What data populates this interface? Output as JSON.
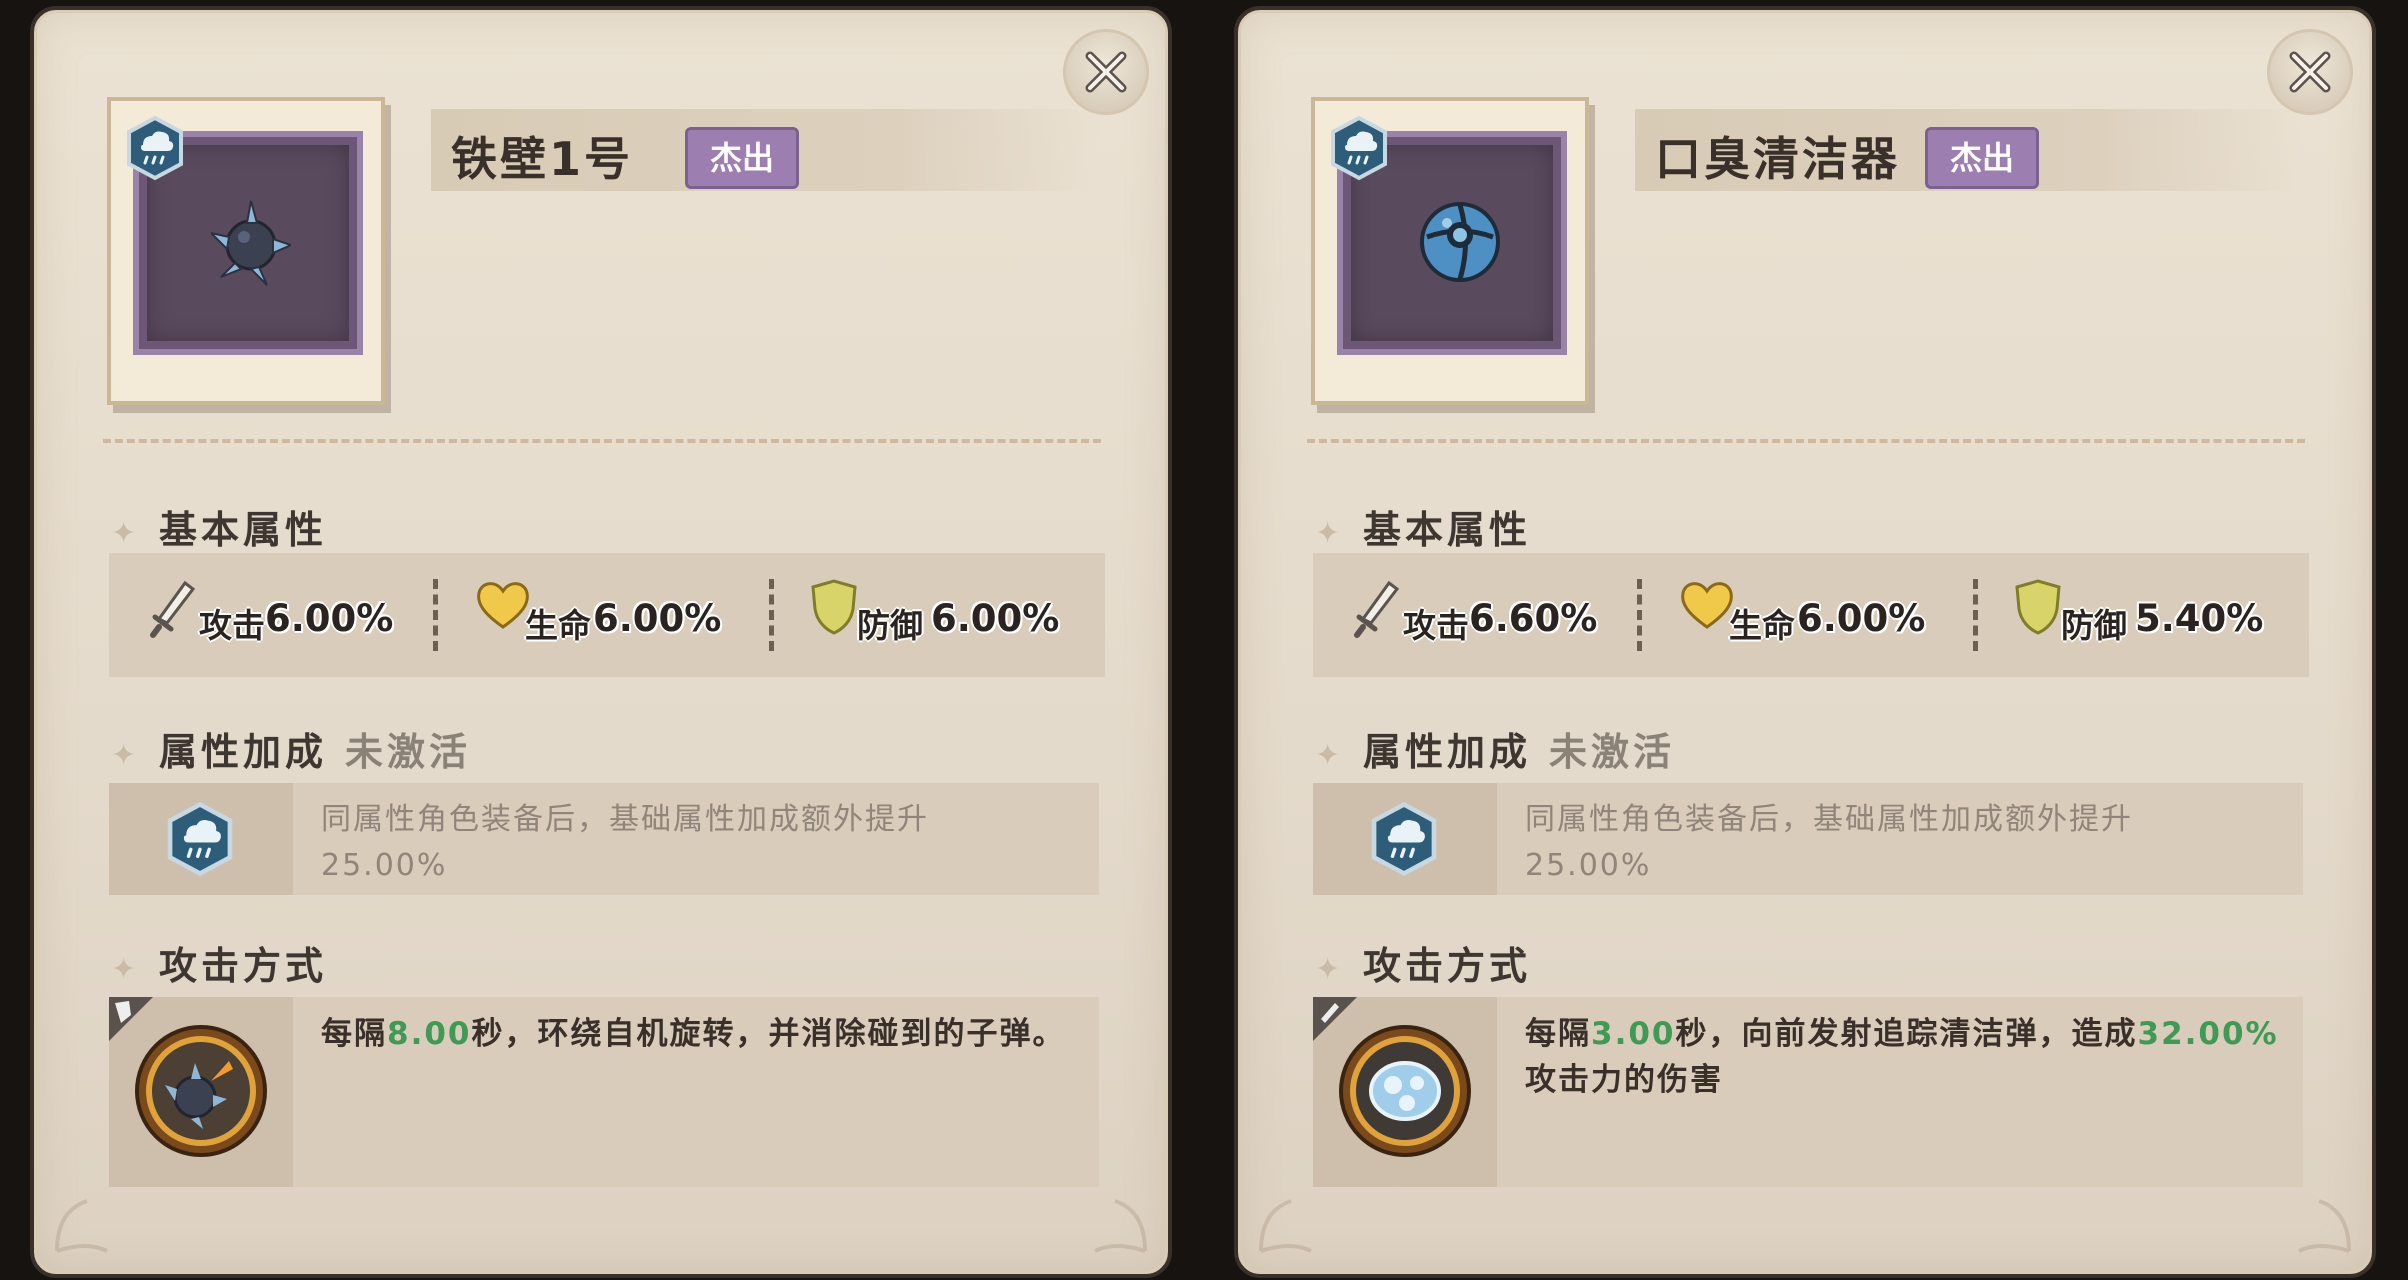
{
  "panels": [
    {
      "item_name": "铁壁1号",
      "rarity": "杰出",
      "sections": {
        "basic": "基本属性",
        "bonus": "属性加成",
        "bonus_status": "未激活",
        "attack": "攻击方式"
      },
      "stats": [
        {
          "label": "攻击",
          "value": "6.00%",
          "icon": "sword-icon"
        },
        {
          "label": "生命",
          "value": "6.00%",
          "icon": "heart-icon"
        },
        {
          "label": "防御",
          "value": "6.00%",
          "icon": "shield-icon"
        }
      ],
      "bonus_text_1": "同属性角色装备后，基础属性加成额外提升",
      "bonus_text_2": "25.00%",
      "attack_pre": "每隔",
      "attack_hl1": "8.00",
      "attack_mid": "秒，环绕自机旋转，并消除碰到的子弹。",
      "attack_hl2": "",
      "attack_post": "",
      "attack_type_icon": "defense-flag-icon",
      "item_icon": "spiked-ball-icon"
    },
    {
      "item_name": "口臭清洁器",
      "rarity": "杰出",
      "sections": {
        "basic": "基本属性",
        "bonus": "属性加成",
        "bonus_status": "未激活",
        "attack": "攻击方式"
      },
      "stats": [
        {
          "label": "攻击",
          "value": "6.60%",
          "icon": "sword-icon"
        },
        {
          "label": "生命",
          "value": "6.00%",
          "icon": "heart-icon"
        },
        {
          "label": "防御",
          "value": "5.40%",
          "icon": "shield-icon"
        }
      ],
      "bonus_text_1": "同属性角色装备后，基础属性加成额外提升",
      "bonus_text_2": "25.00%",
      "attack_pre": "每隔",
      "attack_hl1": "3.00",
      "attack_mid": "秒，向前发射追踪清洁弹，造成",
      "attack_hl2": "32.00%",
      "attack_post": "攻击力的伤害",
      "attack_type_icon": "attack-flag-icon",
      "item_icon": "blue-orb-icon"
    }
  ],
  "colors": {
    "panel_bg": "#e4dacb",
    "rarity_purple": "#9c7fb0",
    "highlight_green": "#3f9a55",
    "text_dark": "#3a302a",
    "element_badge": "#3c6e8a"
  }
}
